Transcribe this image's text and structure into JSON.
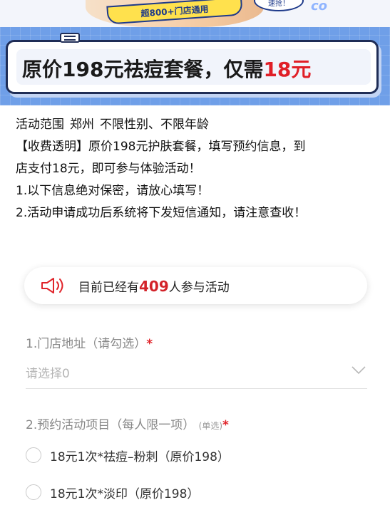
{
  "banner": {
    "promo_text": "超800+门店通用",
    "bubble_text": "速抢！",
    "mark_text": "co"
  },
  "title": {
    "main": "原价198元祛痘套餐，仅需",
    "price": "18元"
  },
  "intro": {
    "scope_label": "活动范围",
    "scope_city": "郑州",
    "scope_limits": "不限性别、不限年龄",
    "fee_line1": "【收费透明】原价198元护肤套餐，填写预约信息，到",
    "fee_line2": "店支付18元，即可参与体验活动！",
    "note1": "1.以下信息绝对保密，请放心填写！",
    "note2": "2.活动申请成功后系统将下发短信通知，请注意查收！"
  },
  "participants": {
    "icon": "speaker-icon",
    "prefix": "目前已经有",
    "count": "409",
    "suffix": "人参与活动"
  },
  "form": {
    "store_label": "1.门店地址（请勾选）",
    "store_required": "*",
    "store_placeholder": "请选择0",
    "project_label": "2.预约活动项目（每人限一项）",
    "project_note": "(单选)",
    "project_required": "*",
    "options": [
      "18元1次*祛痘–粉刺（原价198）",
      "18元1次*淡印（原价198）"
    ]
  },
  "colors": {
    "accent_red": "#e01f27",
    "band_blue": "#6f9fe8",
    "border_navy": "#1f2d56"
  }
}
